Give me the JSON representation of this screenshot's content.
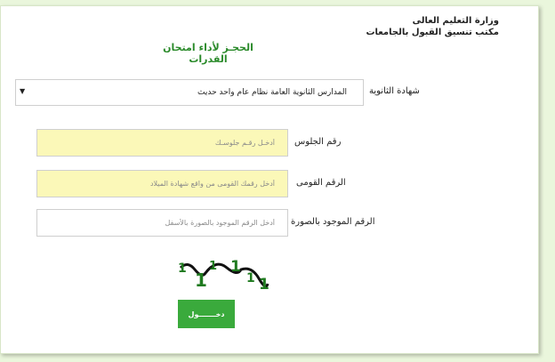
{
  "header": {
    "ministry_name": "وزارة التعليم العالى",
    "office_name": "مكتب تنسيق القبول بالجامعات"
  },
  "form": {
    "title": "الحجـز لأداء امتحان القدرات",
    "certificate": {
      "label": "شهادة الثانوية",
      "selected_value": "المدارس الثانوية العامة نظام عام واحد حديث",
      "arrow_glyph": "▼"
    },
    "seat_number": {
      "label": "رقم الجلوس",
      "placeholder": "أدخـل رقـم جلوسـك"
    },
    "national_id": {
      "label": "الرقم القومى",
      "placeholder": "أدخل رقمك القومى من واقع شهادة الميلاد"
    },
    "captcha_code": {
      "label": "الرقم الموجود بالصورة",
      "placeholder": "أدخل الرقم الموجود بالصورة بالأسفل"
    },
    "captcha_image_digits": "111111",
    "submit_label": "دخـــــــول"
  },
  "colors": {
    "page_background": "#eaf6dc",
    "title_green": "#2a8a2a",
    "input_yellow": "#fbf8b8",
    "button_green": "#3aaa3c",
    "captcha_green": "#1f7a1f"
  }
}
